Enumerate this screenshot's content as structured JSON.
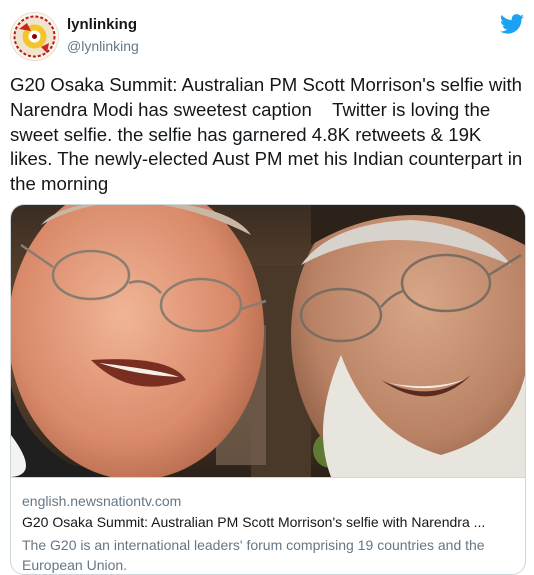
{
  "user": {
    "name": "lynlinking",
    "handle": "@lynlinking"
  },
  "tweet": {
    "text": "G20 Osaka Summit: Australian PM Scott Morrison's selfie with Narendra Modi has sweetest caption    Twitter is loving the sweet selfie. the selfie has garnered 4.8K retweets & 19K likes. The newly-elected Aust PM met his Indian counterpart in the morning"
  },
  "card": {
    "domain": "english.newsnationtv.com",
    "title": "G20 Osaka Summit: Australian PM Scott Morrison's selfie with Narendra ...",
    "description": "The G20 is an international leaders' forum comprising 19 countries and the European Union."
  },
  "icons": {
    "brand": "twitter-bird-icon"
  },
  "colors": {
    "twitter_blue": "#1da1f2",
    "secondary_text": "#657786",
    "border": "#ccd6dd"
  }
}
